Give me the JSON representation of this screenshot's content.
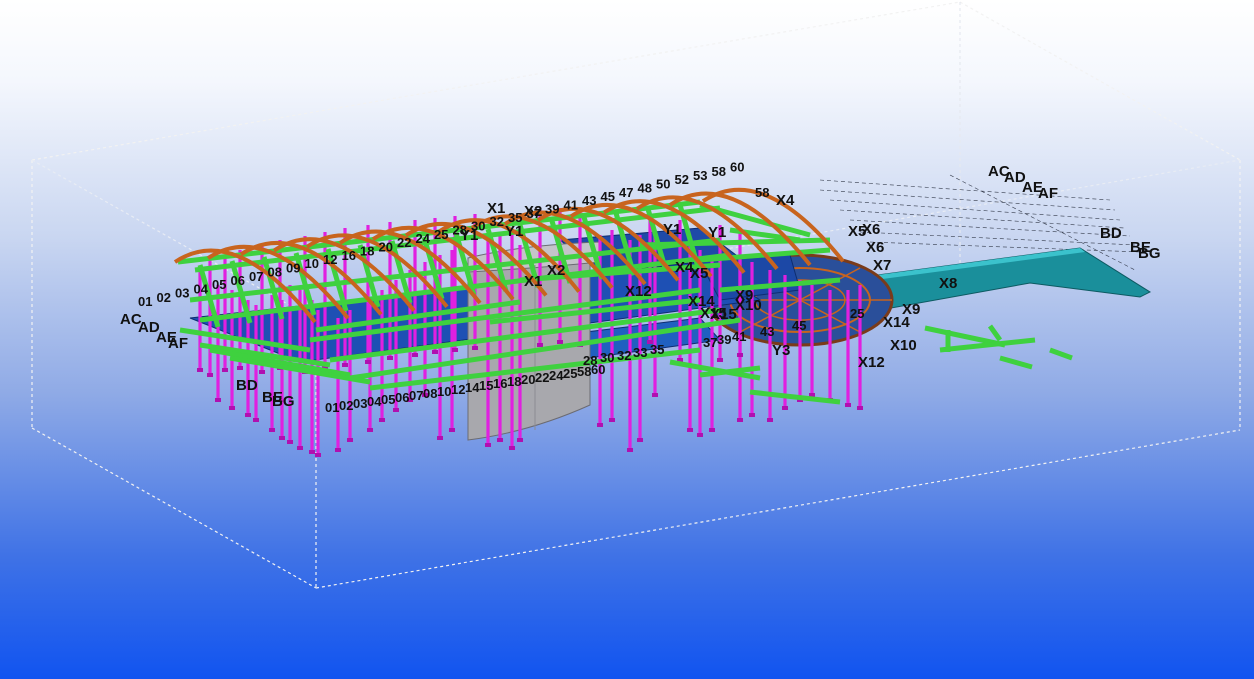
{
  "app": {
    "title": ""
  },
  "colors": {
    "background_top": "#ffffff",
    "background_bottom": "#1154f0",
    "work_area_line": "#eeeeee",
    "column": "#e020e0",
    "beam": "#3fd13f",
    "arch_rafter": "#c8641e",
    "slab_blue": "#1e50b4",
    "slab_teal": "#1a8f9b",
    "concrete_wall": "#a8a8ad"
  },
  "grid_labels": {
    "x": [
      "X1",
      "X2",
      "X1",
      "X2",
      "X4",
      "X5",
      "X12",
      "X6",
      "X5",
      "X6",
      "X7",
      "X8",
      "X9",
      "X14",
      "X9",
      "X10",
      "X14",
      "X15",
      "X10",
      "X12",
      "X4",
      "X15"
    ],
    "y": [
      "Y1",
      "Y1",
      "Y1",
      "Y1",
      "Y3"
    ],
    "numbers": [
      "01",
      "02",
      "03",
      "04",
      "05",
      "06",
      "07",
      "08",
      "09",
      "10",
      "12",
      "16",
      "18",
      "20",
      "22",
      "24",
      "25",
      "28",
      "30",
      "32",
      "35",
      "37",
      "39",
      "41",
      "43",
      "45",
      "47",
      "48",
      "50",
      "52",
      "53",
      "58",
      "60",
      "01",
      "02",
      "03",
      "04",
      "05",
      "06",
      "07",
      "08",
      "10",
      "12",
      "14",
      "15",
      "16",
      "18",
      "20",
      "22",
      "24",
      "25",
      "58",
      "60",
      "58",
      "37",
      "39",
      "41",
      "43",
      "45",
      "25",
      "28",
      "30",
      "32",
      "33",
      "35"
    ],
    "axis_letters": [
      "AC",
      "AD",
      "AE",
      "AF",
      "BD",
      "BE",
      "BG",
      "AC",
      "AD",
      "AE",
      "AF",
      "BD",
      "BE",
      "BG"
    ]
  }
}
